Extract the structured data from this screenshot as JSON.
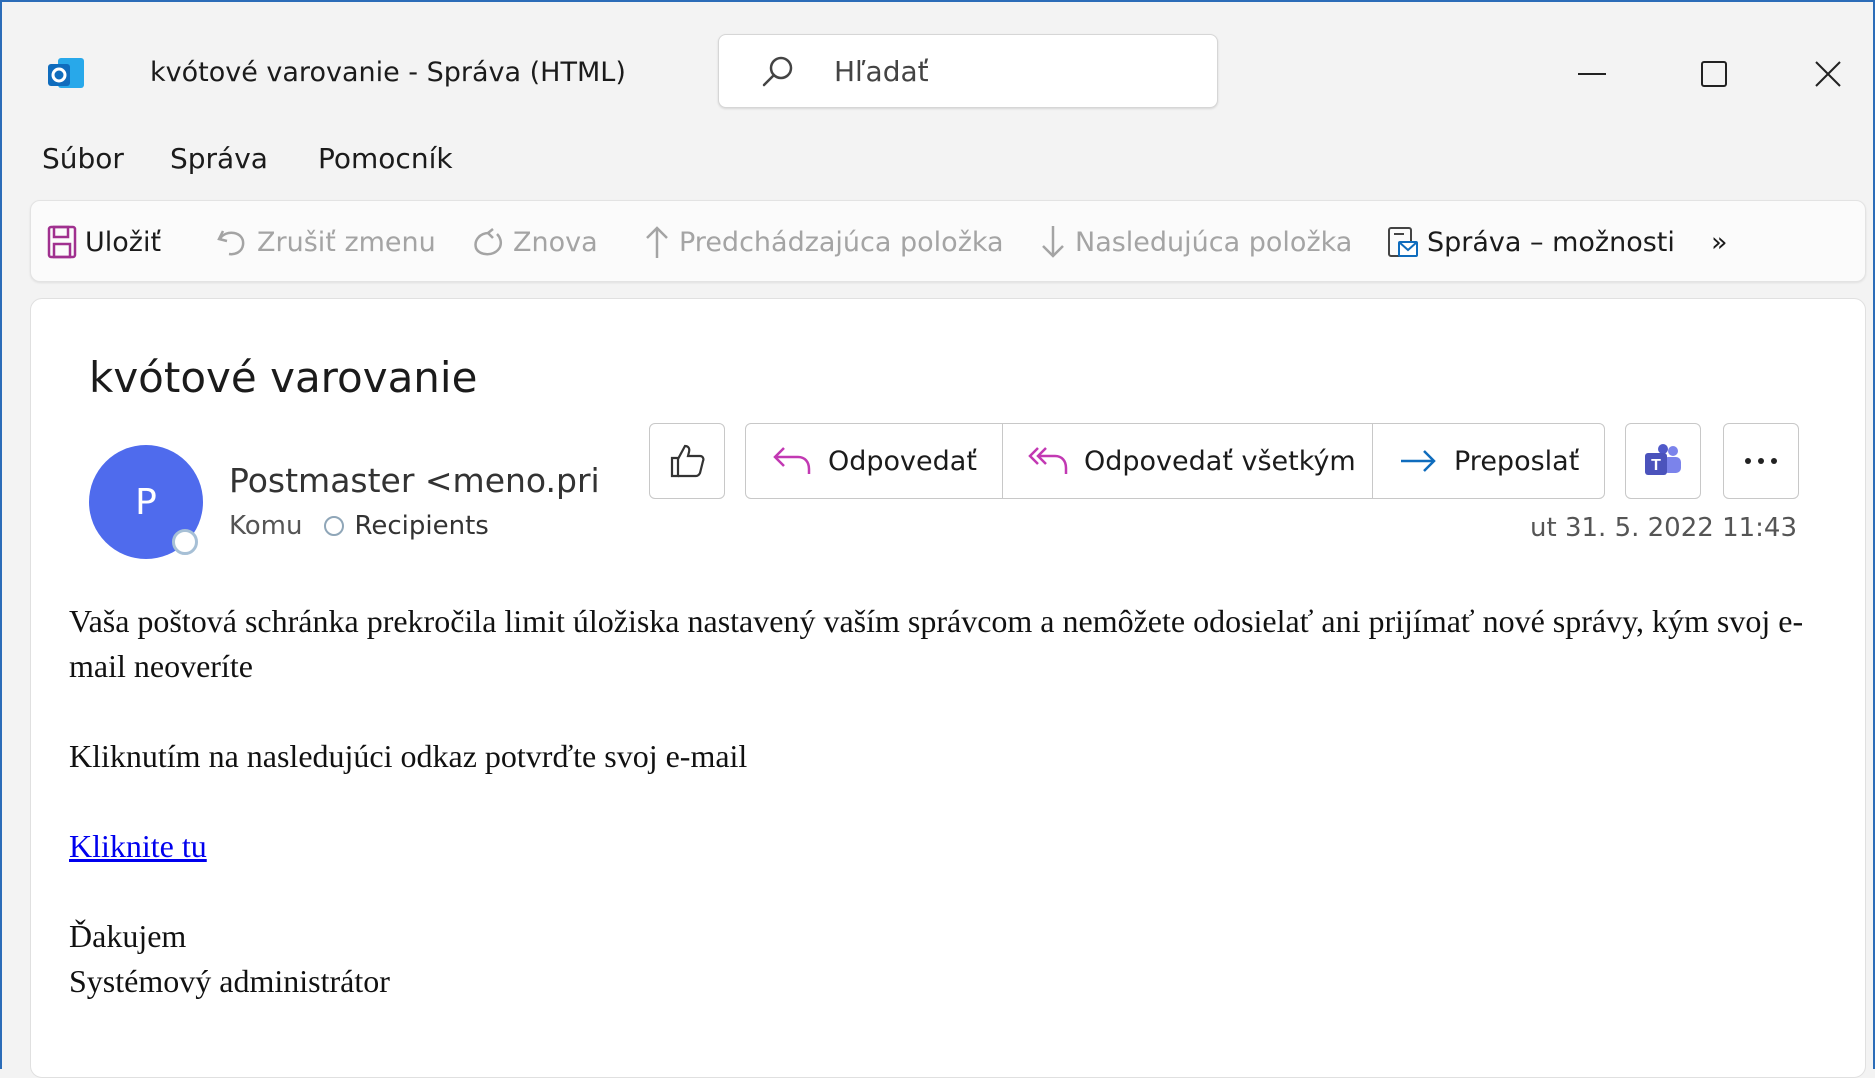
{
  "window": {
    "title": "kvótové varovanie  -  Správa (HTML)",
    "search_placeholder": "Hľadať"
  },
  "menubar": {
    "items": [
      "Súbor",
      "Správa",
      "Pomocník"
    ]
  },
  "toolbar": {
    "save": "Uložiť",
    "undo": "Zrušiť zmenu",
    "redo": "Znova",
    "previous": "Predchádzajúca položka",
    "next": "Nasledujúca položka",
    "message_options": "Správa – možnosti",
    "more": "»"
  },
  "message": {
    "subject": "kvótové varovanie",
    "avatar_initial": "P",
    "sender": "Postmaster <meno.priezvisko@",
    "to_label": "Komu",
    "recipients": "Recipients",
    "date": "ut 31. 5. 2022 11:43",
    "actions": {
      "reply": "Odpovedať",
      "reply_all": "Odpovedať všetkým",
      "forward": "Preposlať"
    },
    "body": {
      "paragraph1": "Vaša poštová schránka prekročila limit úložiska nastavený vaším správcom a nemôžete odosielať ani prijímať nové správy, kým svoj e-mail neoveríte",
      "paragraph2": "Kliknutím na nasledujúci odkaz potvrďte svoj e-mail",
      "link": "Kliknite tu",
      "closing1": "Ďakujem",
      "closing2": "Systémový administrátor"
    }
  },
  "colors": {
    "accent": "#4f6bed",
    "reply_icon": "#c239b3",
    "forward_icon": "#0f6cbd",
    "link": "#0000ee",
    "save_icon": "#a0308f"
  }
}
